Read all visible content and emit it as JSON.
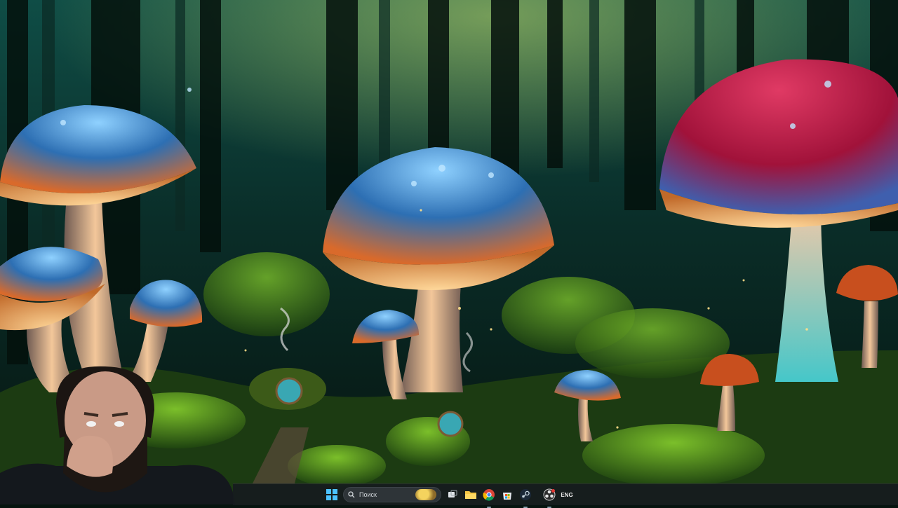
{
  "wallpaper": {
    "scene": "mushroom-forest",
    "colors": {
      "forest_top": "#0d3a33",
      "moss": "#3e7a1a",
      "glow": "#f6b25a",
      "cap_blue": "#2d6fb3",
      "cap_red": "#a1123a"
    }
  },
  "webcam": {
    "present": true
  },
  "taskbar": {
    "search_placeholder": "Поиск",
    "language_indicator": "ENG",
    "icons": {
      "start": "windows-start-icon",
      "search": "search-icon",
      "task_view": "task-view-icon",
      "explorer": "file-explorer-icon",
      "chrome": "chrome-icon",
      "store": "microsoft-store-icon",
      "steam": "steam-icon",
      "obs": "obs-recording-icon"
    },
    "colors": {
      "background": "#161b1e",
      "accent": "#4cc2ff"
    }
  }
}
